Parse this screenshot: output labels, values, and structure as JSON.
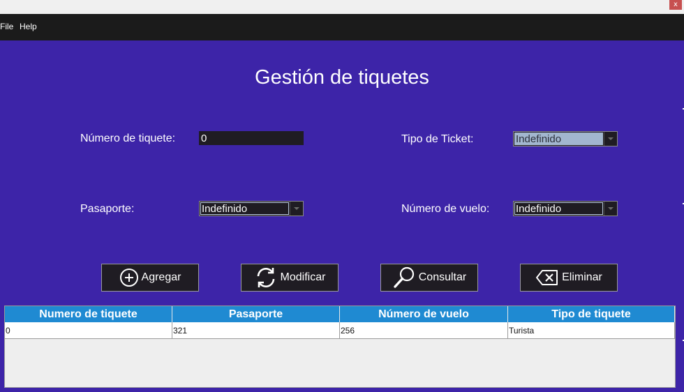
{
  "window": {
    "close_label": "x"
  },
  "menu": {
    "file": "File",
    "help": "Help"
  },
  "title": "Gestión de tiquetes",
  "form": {
    "ticket_number_label": "Número de tiquete:",
    "ticket_number_value": "0",
    "ticket_type_label": "Tipo de Ticket:",
    "ticket_type_value": "Indefinido",
    "passport_label": "Pasaporte:",
    "passport_value": "Indefinido",
    "flight_label": "Número de vuelo:",
    "flight_value": "Indefinido"
  },
  "buttons": {
    "add": "Agregar",
    "modify": "Modificar",
    "search": "Consultar",
    "delete": "Eliminar"
  },
  "table": {
    "headers": [
      "Numero de tiquete",
      "Pasaporte",
      "Número de vuelo",
      "Tipo de tiquete"
    ],
    "rows": [
      [
        "0",
        "321",
        "256",
        "Turista"
      ]
    ]
  },
  "colors": {
    "background": "#3d24a8",
    "menubar": "#1b1b1b",
    "table_header": "#1f8ad2",
    "control_dark": "#1f1c23"
  },
  "icons": {
    "add": "plus-circle-icon",
    "modify": "refresh-icon",
    "search": "magnifier-icon",
    "delete": "backspace-icon"
  }
}
